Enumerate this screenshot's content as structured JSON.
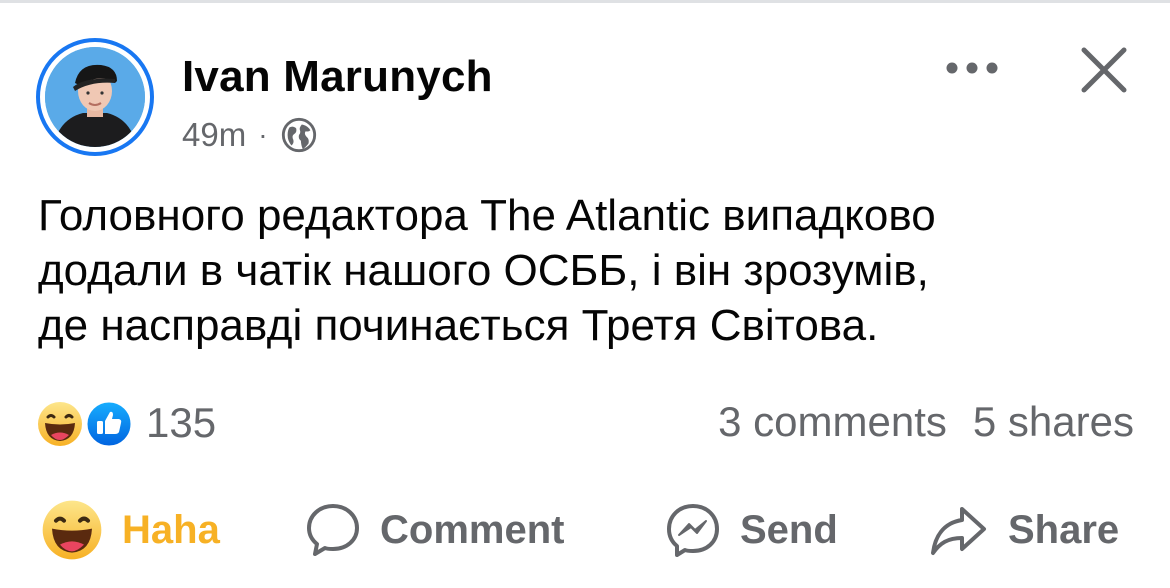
{
  "post": {
    "author": "Ivan Marunych",
    "time": "49m",
    "separator": "·",
    "audience_icon": "globe-icon",
    "text_lines": [
      "Головного редактора The Atlantic випадково",
      "додали в чатік нашого ОСББ, і він зрозумів,",
      "де насправді починається Третя Світова."
    ]
  },
  "header": {
    "more_icon": "more-options-icon",
    "close_icon": "close-icon"
  },
  "engagement": {
    "reaction_icons": [
      "haha-icon",
      "like-icon"
    ],
    "reaction_count": "135",
    "comments": "3 comments",
    "shares": "5 shares"
  },
  "actions": {
    "haha": "Haha",
    "comment": "Comment",
    "send": "Send",
    "share": "Share"
  },
  "colors": {
    "accent": "#1877f2",
    "secondary_text": "#65676b",
    "haha_yellow": "#f7b125"
  }
}
